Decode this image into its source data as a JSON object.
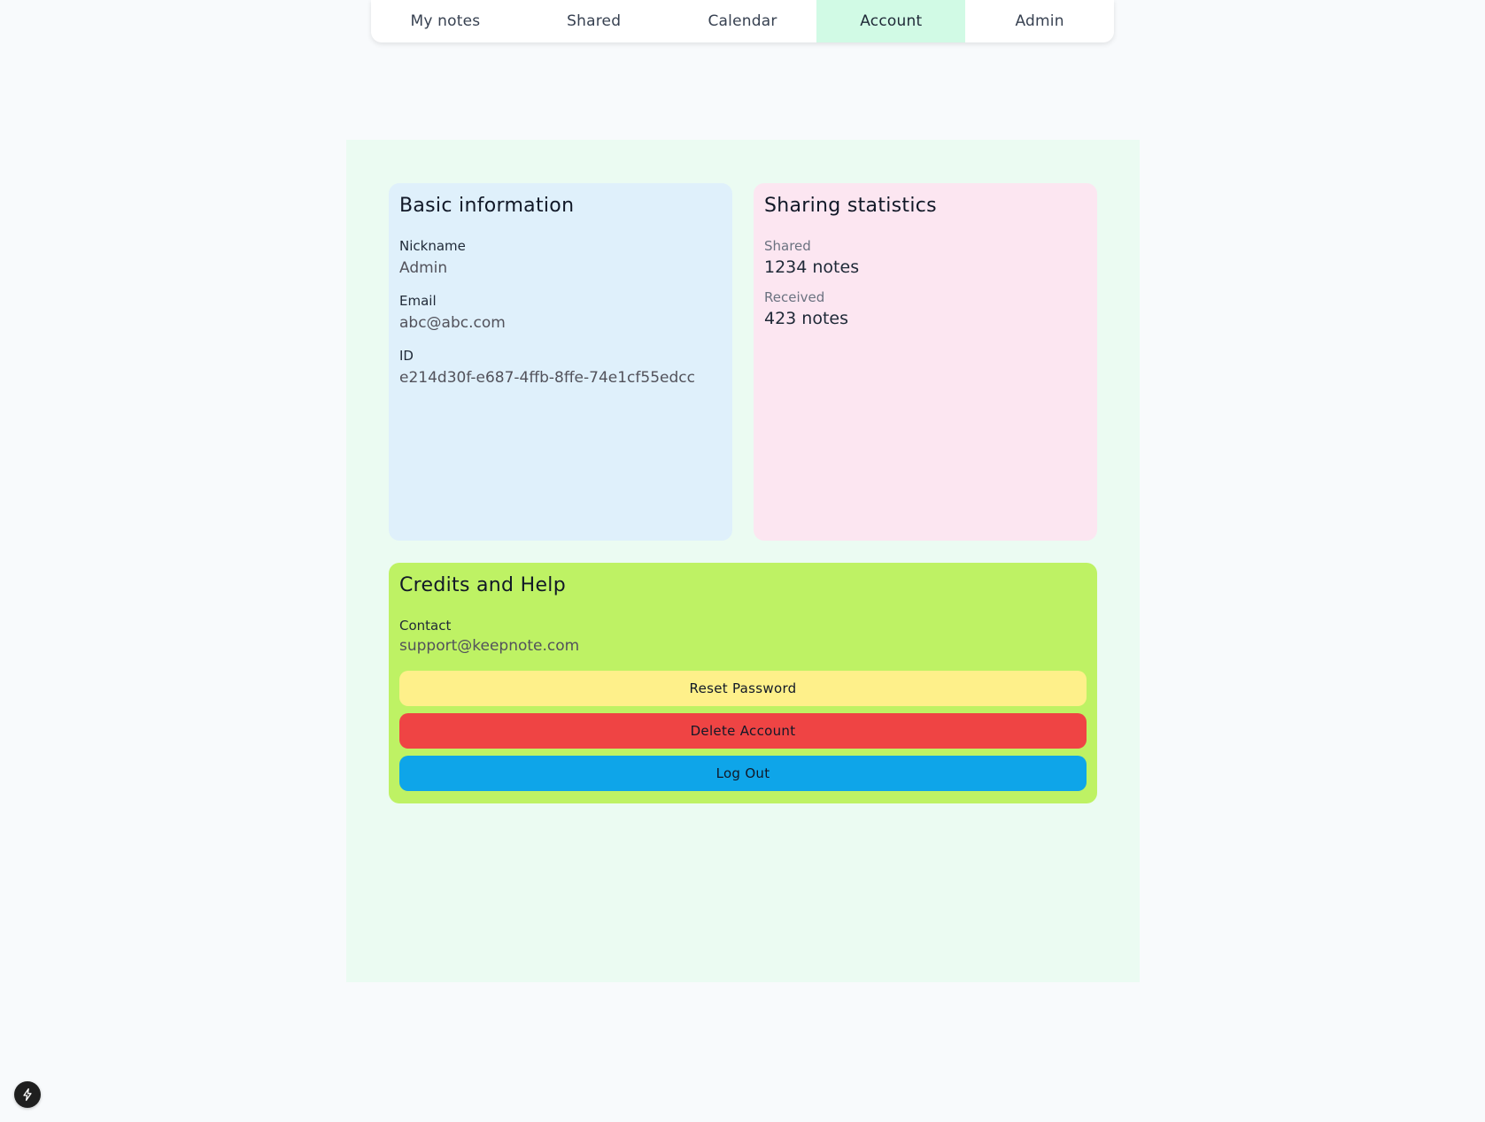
{
  "nav": {
    "tabs": [
      {
        "label": "My notes",
        "active": false
      },
      {
        "label": "Shared",
        "active": false
      },
      {
        "label": "Calendar",
        "active": false
      },
      {
        "label": "Account",
        "active": true
      },
      {
        "label": "Admin",
        "active": false
      }
    ],
    "active_color": "#d1fae5"
  },
  "basic_info": {
    "title": "Basic information",
    "nickname_label": "Nickname",
    "nickname_value": "Admin",
    "email_label": "Email",
    "email_value": "abc@abc.com",
    "id_label": "ID",
    "id_value": "e214d30f-e687-4ffb-8ffe-74e1cf55edcc",
    "background": "#dff0fb"
  },
  "sharing": {
    "title": "Sharing statistics",
    "shared_label": "Shared",
    "shared_value": "1234 notes",
    "received_label": "Received",
    "received_value": "423 notes",
    "background": "#fce6f1"
  },
  "credits": {
    "title": "Credits and Help",
    "contact_label": "Contact",
    "contact_value": "support@keepnote.com",
    "background": "#bef264",
    "reset_label": "Reset Password",
    "delete_label": "Delete Account",
    "logout_label": "Log Out",
    "reset_color": "#fef08a",
    "delete_color": "#ef4444",
    "logout_color": "#0ea5e9"
  },
  "corner_badge": {
    "icon": "lightning-bolt-icon"
  }
}
